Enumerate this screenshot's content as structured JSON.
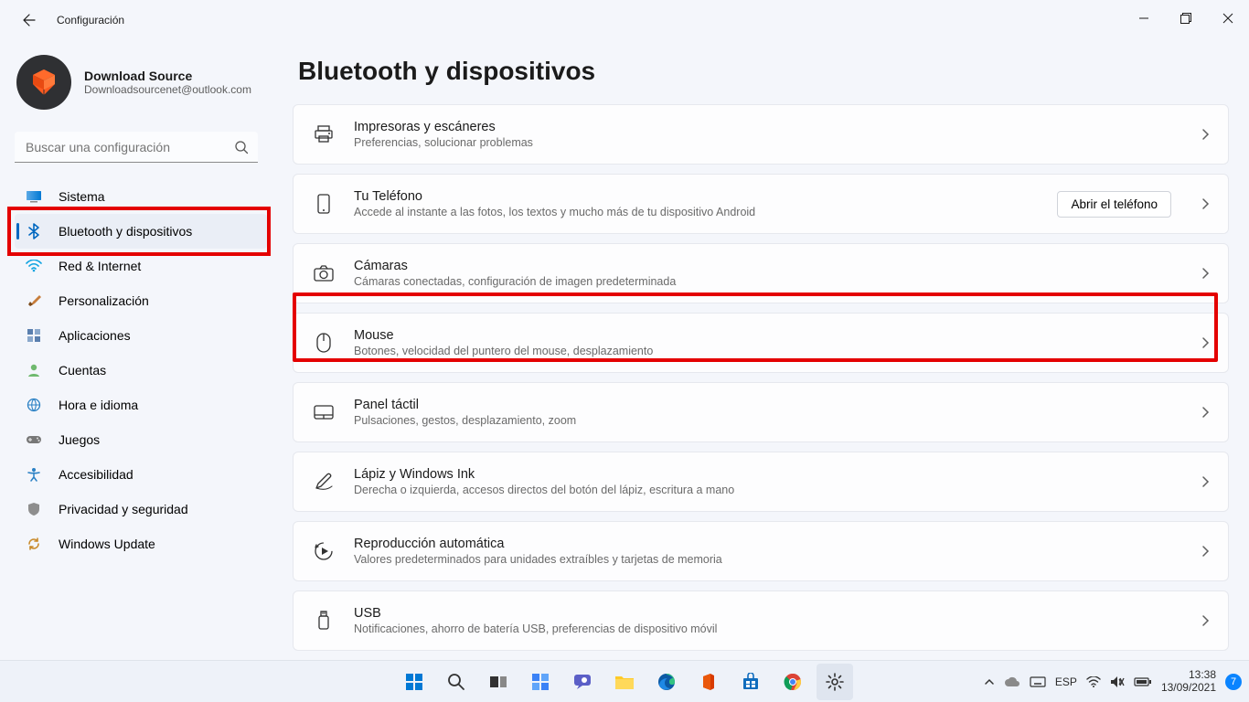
{
  "window": {
    "title": "Configuración"
  },
  "profile": {
    "name": "Download Source",
    "email": "Downloadsourcenet@outlook.com"
  },
  "search": {
    "placeholder": "Buscar una configuración"
  },
  "nav": {
    "items": [
      {
        "icon": "monitor",
        "label": "Sistema"
      },
      {
        "icon": "bluetooth",
        "label": "Bluetooth y dispositivos"
      },
      {
        "icon": "wifi",
        "label": "Red & Internet"
      },
      {
        "icon": "brush",
        "label": "Personalización"
      },
      {
        "icon": "grid",
        "label": "Aplicaciones"
      },
      {
        "icon": "person",
        "label": "Cuentas"
      },
      {
        "icon": "globe",
        "label": "Hora e idioma"
      },
      {
        "icon": "gamepad",
        "label": "Juegos"
      },
      {
        "icon": "accessibility",
        "label": "Accesibilidad"
      },
      {
        "icon": "shield",
        "label": "Privacidad y seguridad"
      },
      {
        "icon": "update",
        "label": "Windows Update"
      }
    ],
    "active_index": 1
  },
  "page": {
    "title": "Bluetooth y dispositivos"
  },
  "cards": [
    {
      "icon": "printer",
      "title": "Impresoras y escáneres",
      "sub": "Preferencias, solucionar problemas"
    },
    {
      "icon": "phone",
      "title": "Tu Teléfono",
      "sub": "Accede al instante a las fotos, los textos y mucho más de tu dispositivo Android",
      "action": "Abrir el teléfono"
    },
    {
      "icon": "camera",
      "title": "Cámaras",
      "sub": "Cámaras conectadas, configuración de imagen predeterminada"
    },
    {
      "icon": "mouse",
      "title": "Mouse",
      "sub": "Botones, velocidad del puntero del mouse, desplazamiento"
    },
    {
      "icon": "touchpad",
      "title": "Panel táctil",
      "sub": "Pulsaciones, gestos, desplazamiento, zoom"
    },
    {
      "icon": "pen",
      "title": "Lápiz y Windows Ink",
      "sub": "Derecha o izquierda, accesos directos del botón del lápiz, escritura a mano"
    },
    {
      "icon": "autoplay",
      "title": "Reproducción automática",
      "sub": "Valores predeterminados para unidades extraíbles y tarjetas de memoria"
    },
    {
      "icon": "usb",
      "title": "USB",
      "sub": "Notificaciones, ahorro de batería USB, preferencias de dispositivo móvil"
    }
  ],
  "taskbar": {
    "lang": "ESP",
    "time": "13:38",
    "date": "13/09/2021",
    "notif_count": "7"
  }
}
